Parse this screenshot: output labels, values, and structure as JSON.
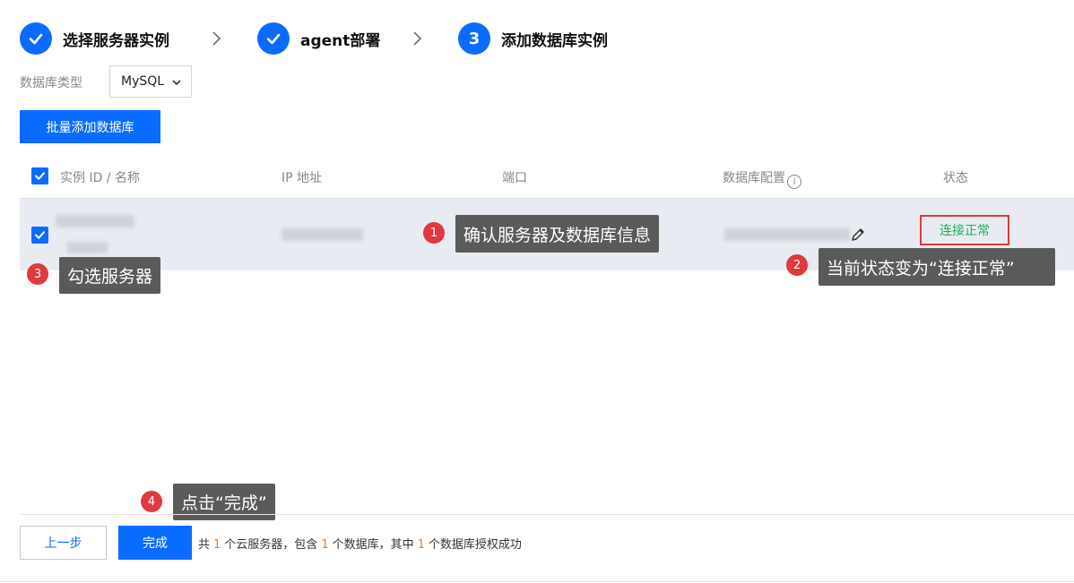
{
  "steps": [
    {
      "label": "选择服务器实例",
      "state": "done"
    },
    {
      "label": "agent部署",
      "state": "done"
    },
    {
      "label": "添加数据库实例",
      "state": "active",
      "number": "3"
    }
  ],
  "filter": {
    "label": "数据库类型",
    "selected": "MySQL"
  },
  "batch_button": "批量添加数据库",
  "table": {
    "columns": [
      "实例 ID / 名称",
      "IP 地址",
      "端口",
      "数据库配置",
      "状态"
    ],
    "row": {
      "checked": true,
      "status": "连接正常"
    }
  },
  "callouts": [
    {
      "number": "1",
      "text": "确认服务器及数据库信息"
    },
    {
      "number": "2",
      "text": "当前状态变为“连接正常”"
    },
    {
      "number": "3",
      "text": "勾选服务器"
    },
    {
      "number": "4",
      "text": "点击“完成”"
    }
  ],
  "footer": {
    "prev_label": "上一步",
    "done_label": "完成",
    "summary": {
      "p1": "共",
      "servers": "1",
      "p2": "个云服务器，包含",
      "databases": "1",
      "p3": "个数据库，其中",
      "authorized": "1",
      "p4": "个数据库授权成功"
    }
  },
  "colors": {
    "primary": "#0a6cff",
    "callout_badge": "#e0393e",
    "status_ok": "#1fae5b",
    "highlight_border": "#e0393e",
    "count": "#f07a1e"
  }
}
